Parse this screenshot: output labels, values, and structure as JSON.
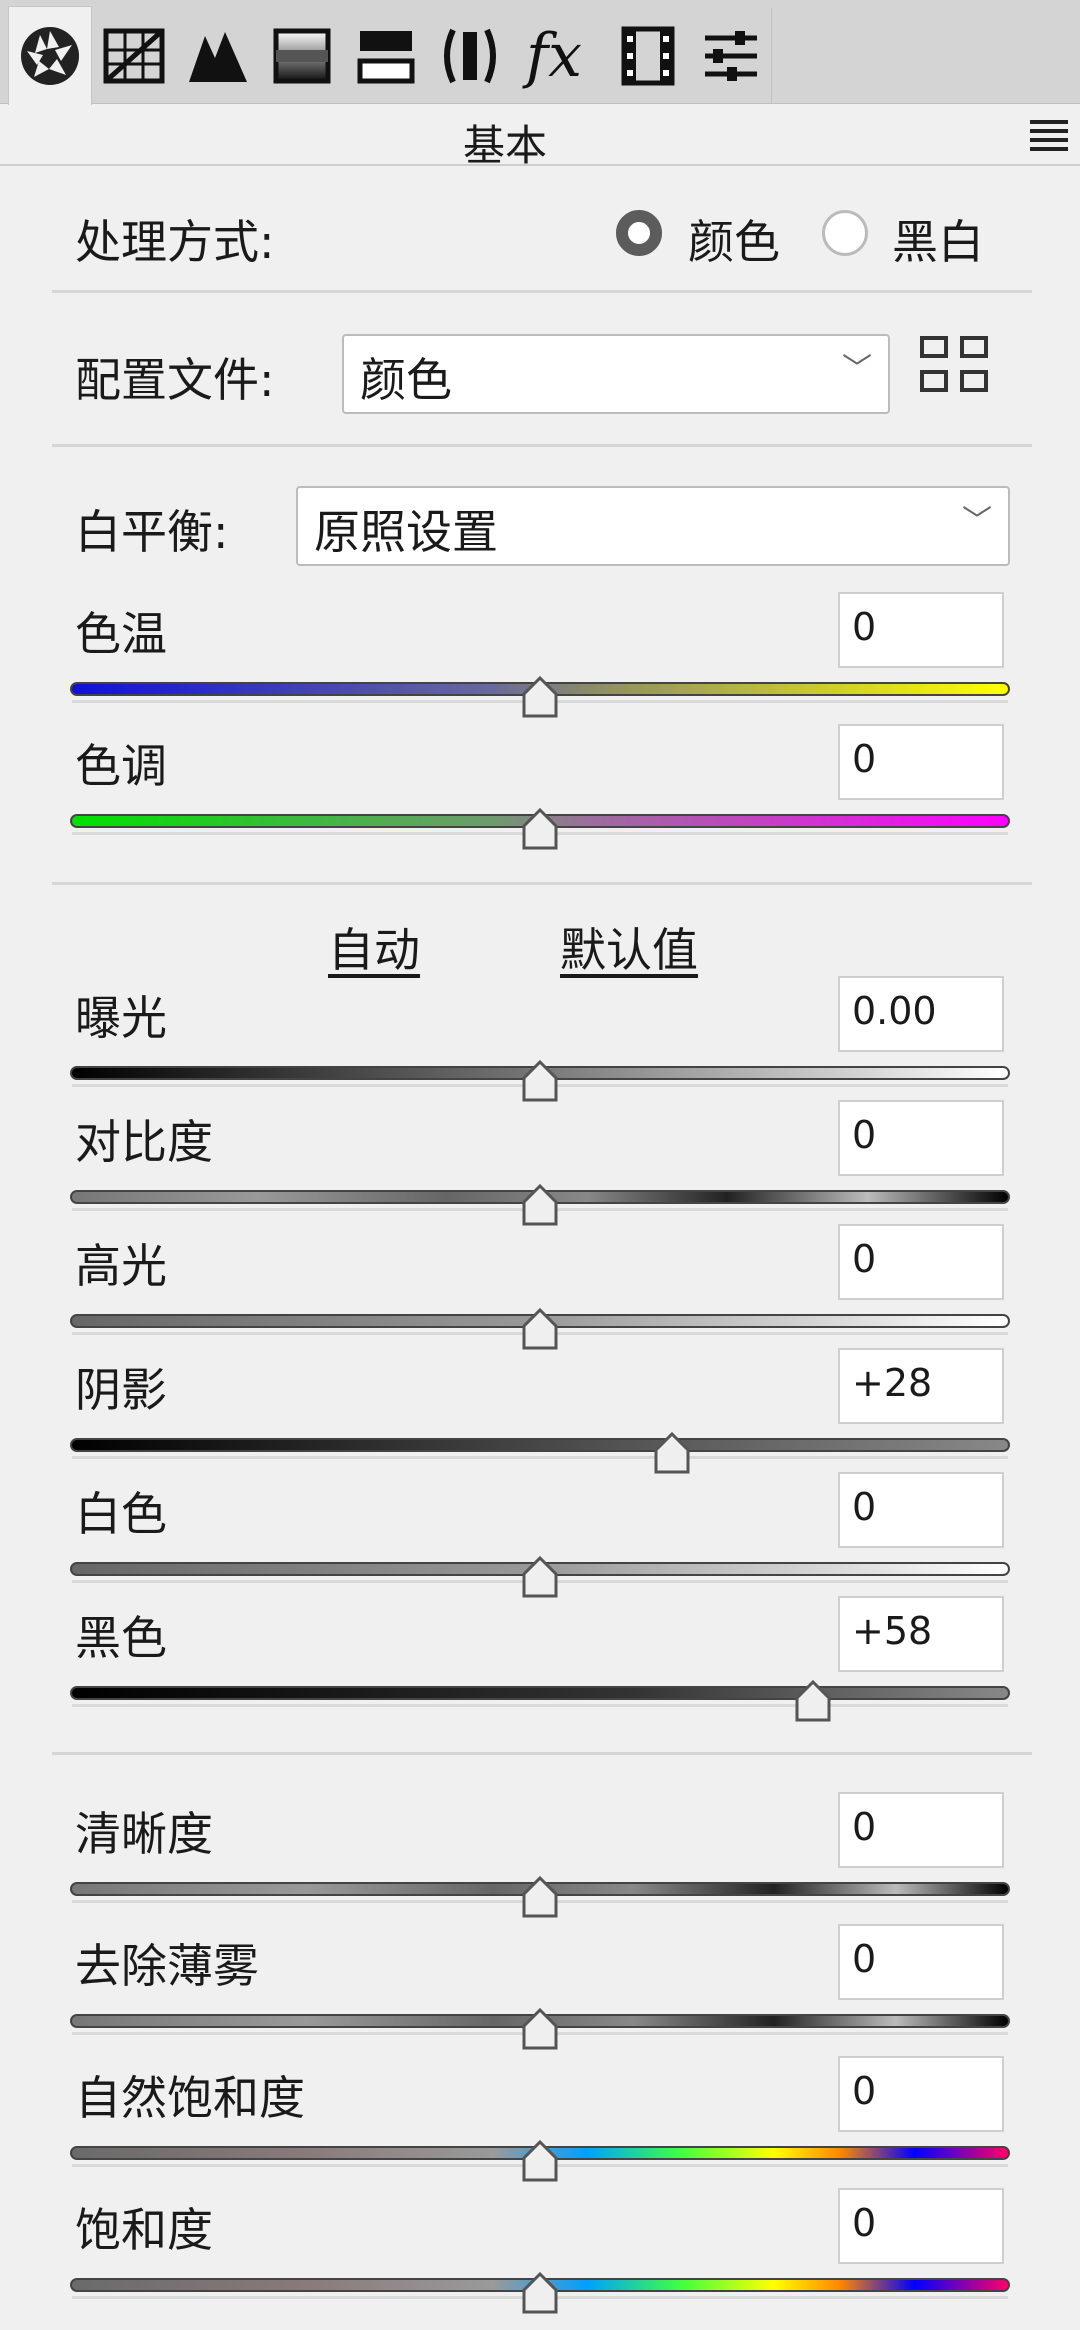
{
  "toolbar": {
    "icons": [
      "aperture-icon",
      "tone-curve-icon",
      "detail-icon",
      "hsl-icon",
      "split-toning-icon",
      "lens-icon",
      "fx-icon",
      "calibration-icon",
      "presets-icon"
    ],
    "fx_label": "fx"
  },
  "panel": {
    "title": "基本"
  },
  "treatment": {
    "label": "处理方式:",
    "options": [
      "颜色",
      "黑白"
    ],
    "selected": "颜色"
  },
  "profile": {
    "label": "配置文件:",
    "value": "颜色"
  },
  "white_balance": {
    "label": "白平衡:",
    "value": "原照设置"
  },
  "auto_label": "自动",
  "default_label": "默认值",
  "sliders": [
    {
      "id": "temp",
      "label": "色温",
      "value": "0",
      "position": 0.5
    },
    {
      "id": "tint",
      "label": "色调",
      "value": "0",
      "position": 0.5
    },
    {
      "id": "exposure",
      "label": "曝光",
      "value": "0.00",
      "position": 0.5
    },
    {
      "id": "contrast",
      "label": "对比度",
      "value": "0",
      "position": 0.5
    },
    {
      "id": "highlights",
      "label": "高光",
      "value": "0",
      "position": 0.5
    },
    {
      "id": "shadows",
      "label": "阴影",
      "value": "+28",
      "position": 0.64
    },
    {
      "id": "whites",
      "label": "白色",
      "value": "0",
      "position": 0.5
    },
    {
      "id": "blacks",
      "label": "黑色",
      "value": "+58",
      "position": 0.79
    },
    {
      "id": "clarity",
      "label": "清晰度",
      "value": "0",
      "position": 0.5
    },
    {
      "id": "dehaze",
      "label": "去除薄雾",
      "value": "0",
      "position": 0.5
    },
    {
      "id": "vibrance",
      "label": "自然饱和度",
      "value": "0",
      "position": 0.5
    },
    {
      "id": "saturation",
      "label": "饱和度",
      "value": "0",
      "position": 0.5
    }
  ],
  "colors": {
    "accent": "#5c5c5c",
    "panel_bg": "#f0f0f0",
    "toolbar_bg": "#d4d4d4"
  }
}
